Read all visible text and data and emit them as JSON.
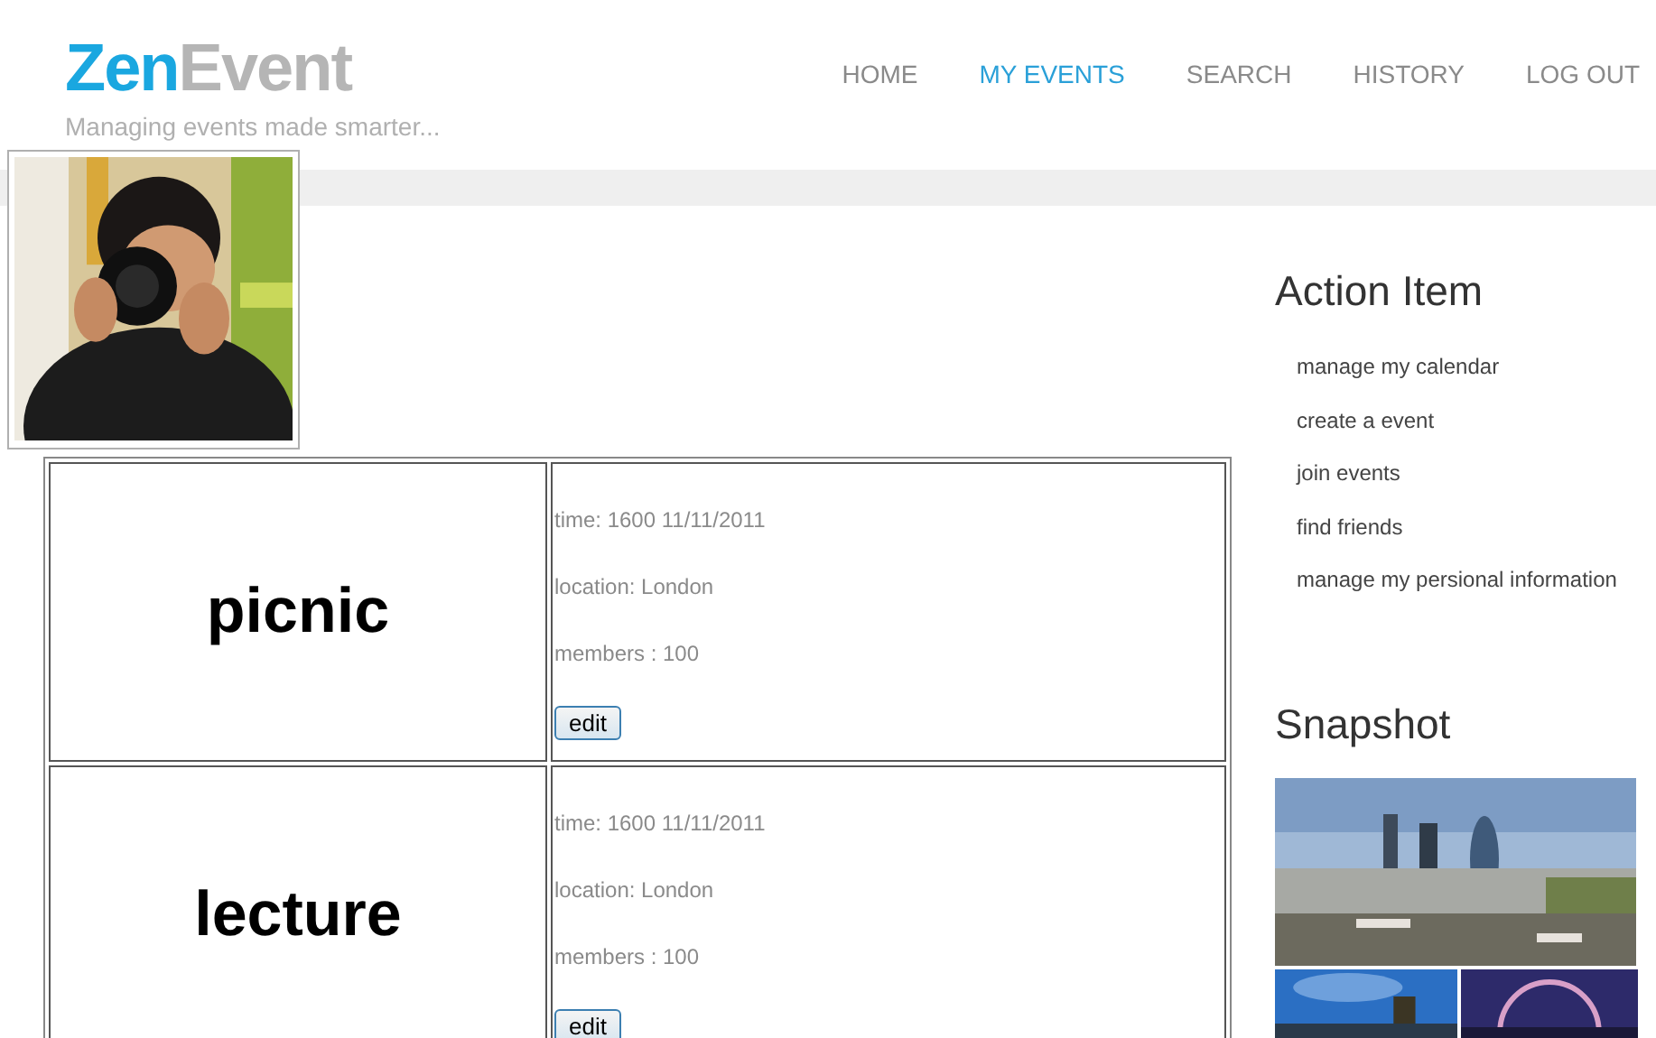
{
  "logo": {
    "first": "Zen",
    "second": "Event"
  },
  "tagline": "Managing events made smarter...",
  "nav": [
    {
      "label": "HOME",
      "selected": false
    },
    {
      "label": "MY EVENTS",
      "selected": true
    },
    {
      "label": "SEARCH",
      "selected": false
    },
    {
      "label": "HISTORY",
      "selected": false
    },
    {
      "label": "LOG OUT",
      "selected": false
    }
  ],
  "events": [
    {
      "name": "picnic",
      "time": "time: 1600 11/11/2011",
      "location": "location: London",
      "members": "members : 100",
      "button": "edit"
    },
    {
      "name": "lecture",
      "time": "time: 1600 11/11/2011",
      "location": "location: London",
      "members": "members : 100",
      "button": "edit"
    }
  ],
  "action_title": "Action Item",
  "action_items": [
    "manage my calendar",
    "create a event",
    "join events",
    "find friends",
    "manage my persional information"
  ],
  "snapshot_title": "Snapshot"
}
